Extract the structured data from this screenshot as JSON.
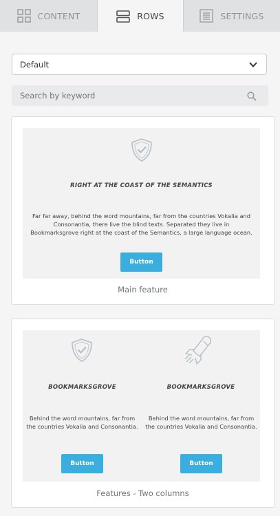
{
  "tabs": [
    {
      "label": "CONTENT",
      "icon": "grid-icon"
    },
    {
      "label": "ROWS",
      "icon": "rows-icon",
      "active": true
    },
    {
      "label": "SETTINGS",
      "icon": "settings-list-icon"
    }
  ],
  "layout_select": {
    "value": "Default"
  },
  "search": {
    "placeholder": "Search by keyword"
  },
  "rows": [
    {
      "caption": "Main feature",
      "title": "RIGHT AT THE COAST OF THE SEMANTICS",
      "text": "Far far away, behind the word mountains, far from the countries Vokalia and Consonantia, there live the blind texts. Separated they live in Bookmarksgrove right at the coast of the Semantics, a large language ocean.",
      "button": "Button",
      "icon": "shield-check-icon"
    },
    {
      "caption": "Features - Two columns",
      "columns": [
        {
          "title": "BOOKMARKSGROVE",
          "text": "Behind the word mountains, far from the countries Vokalia and Consonantia.",
          "button": "Button",
          "icon": "shield-check-icon"
        },
        {
          "title": "BOOKMARKSGROVE",
          "text": "Behind the word mountains, far from the countries Vokalia and Consonantia.",
          "button": "Button",
          "icon": "rocket-icon"
        }
      ]
    }
  ],
  "colors": {
    "accent": "#3baee0",
    "tab_bar": "#dfe1e3",
    "background": "#f5f5f5"
  }
}
